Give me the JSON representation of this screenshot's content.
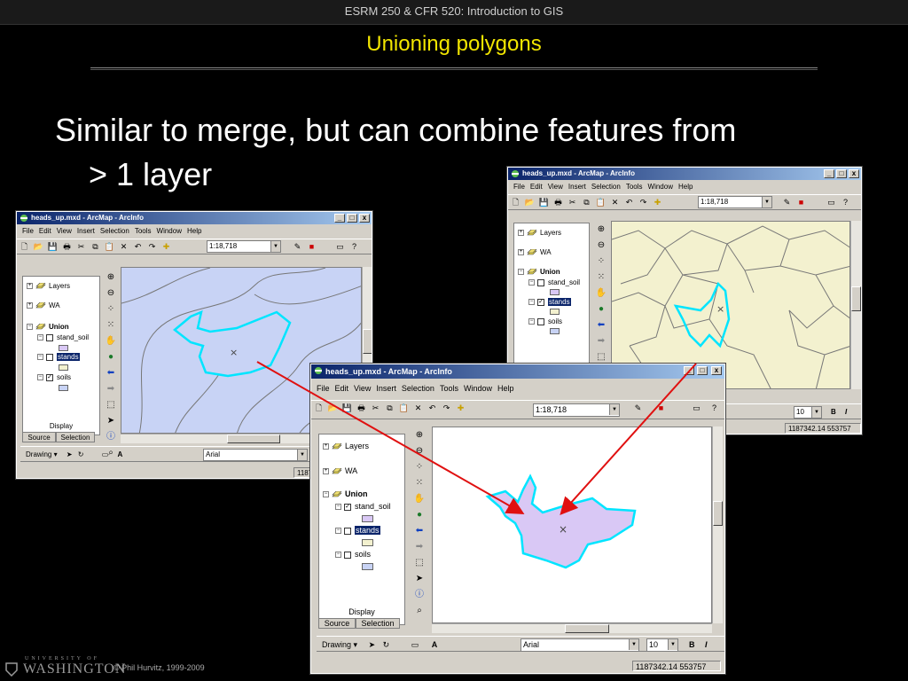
{
  "slide": {
    "course": "ESRM 250 & CFR 520: Introduction to GIS",
    "title": "Unioning polygons",
    "bullet_line1": "Similar to merge, but can combine features from",
    "bullet_line2": "> 1 layer",
    "footer_university": "UNIVERSITY OF",
    "footer_washington": "WASHINGTON",
    "copyright": "© Phil Hurvitz, 1999-2009"
  },
  "colors": {
    "title_yellow": "#f2e600",
    "map_blue": "#c8d3f5",
    "map_yellow": "#f3f1cf",
    "highlight_cyan": "#00e5ff",
    "union_fill": "#d9c8f5",
    "arrow_red": "#e01010"
  },
  "window": {
    "title": "heads_up.mxd - ArcMap - ArcInfo",
    "minimize": "_",
    "maximize": "□",
    "close": "x",
    "menus": [
      "File",
      "Edit",
      "View",
      "Insert",
      "Selection",
      "Tools",
      "Window",
      "Help"
    ],
    "scale": "1:18,718",
    "toc_layers": "Layers",
    "toc_wa": "WA",
    "toc_union": "Union",
    "toc_stand_soil": "stand_soil",
    "toc_stands": "stands",
    "toc_soils": "soils",
    "tab_display": "Display",
    "tab_source": "Source",
    "tab_selection": "Selection",
    "drawing": "Drawing",
    "font": "Arial",
    "font_size": "10",
    "bold": "B",
    "italic": "I",
    "coords": "1187342.14  553757",
    "coords_partial": "1187"
  },
  "icons": [
    "new-icon",
    "open-icon",
    "save-icon",
    "print-icon",
    "cut-icon",
    "copy-icon",
    "paste-icon",
    "delete-icon",
    "undo-icon",
    "redo-icon",
    "add-data-icon",
    "editor-icon",
    "arctoolbox-icon",
    "help-icon",
    "zoom-in-icon",
    "zoom-out-icon",
    "full-extent-icon",
    "pan-icon",
    "globe-icon",
    "back-icon",
    "forward-icon",
    "select-icon",
    "identify-icon",
    "find-icon"
  ]
}
